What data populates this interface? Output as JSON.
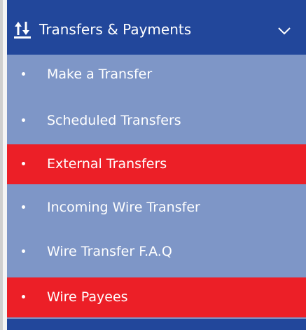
{
  "menu": {
    "title": "Transfers & Payments",
    "title_icon": "transfer-arrows-icon",
    "toggle_icon": "chevron-down-icon",
    "items": [
      {
        "label": "Make a Transfer",
        "active": false
      },
      {
        "label": "Scheduled Transfers",
        "active": false
      },
      {
        "label": "External Transfers",
        "active": true
      },
      {
        "label": "Incoming Wire Transfer",
        "active": false
      },
      {
        "label": "Wire Transfer F.A.Q",
        "active": false
      },
      {
        "label": "Wire Payees",
        "active": true
      }
    ]
  },
  "colors": {
    "header_bg": "#22479b",
    "item_bg": "#7e96c7",
    "highlight_bg": "#ec1f27",
    "text": "#ffffff"
  }
}
